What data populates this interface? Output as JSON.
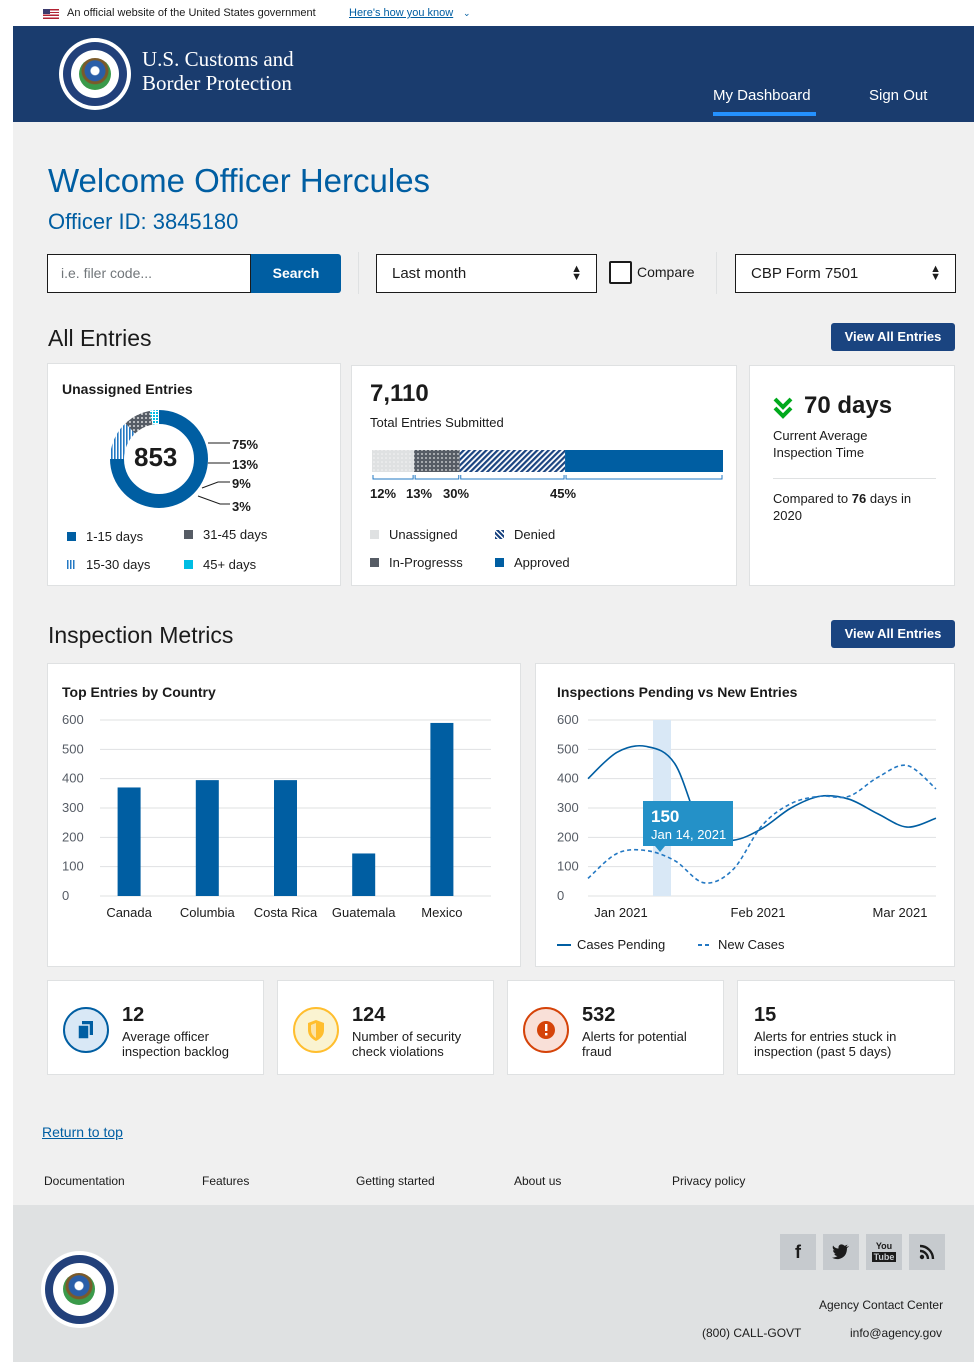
{
  "gov_banner": {
    "text": "An official website of the United States government",
    "link": "Here's how you know"
  },
  "header": {
    "agency_line1": "U.S. Customs and",
    "agency_line2": "Border Protection",
    "nav": [
      "My Dashboard",
      "Sign Out"
    ]
  },
  "welcome": {
    "title": "Welcome Officer Hercules",
    "officer_id": "Officer ID: 3845180"
  },
  "filters": {
    "search_placeholder": "i.e. filer code...",
    "search_button": "Search",
    "period_select": "Last month",
    "compare_label": "Compare",
    "form_select": "CBP Form 7501"
  },
  "all_entries": {
    "title": "All Entries",
    "view_button": "View All Entries",
    "unassigned": {
      "title": "Unassigned Entries",
      "total": "853",
      "percent_labels": [
        "75%",
        "13%",
        "9%",
        "3%"
      ],
      "legend": [
        "1-15 days",
        "31-45 days",
        "15-30 days",
        "45+ days"
      ]
    },
    "submitted": {
      "total": "7,110",
      "label": "Total Entries Submitted",
      "percent_labels": [
        "12%",
        "13%",
        "30%",
        "45%"
      ],
      "legend": [
        "Unassigned",
        "Denied",
        "In-Progresss",
        "Approved"
      ]
    },
    "inspection_time": {
      "value": "70 days",
      "label": "Current Average Inspection Time",
      "compare_prefix": "Compared to",
      "compare_value": "76",
      "compare_suffix": "days in 2020"
    }
  },
  "inspection_metrics": {
    "title": "Inspection Metrics",
    "view_button": "View All Entries"
  },
  "chart_data": [
    {
      "type": "bar",
      "title": "Top Entries by Country",
      "categories": [
        "Canada",
        "Columbia",
        "Costa Rica",
        "Guatemala",
        "Mexico"
      ],
      "values": [
        370,
        395,
        395,
        145,
        590
      ],
      "ylim": [
        0,
        600
      ],
      "yticks": [
        "600",
        "500",
        "400",
        "300",
        "200",
        "100",
        "0"
      ],
      "grid": true,
      "color": "#005ea2"
    },
    {
      "type": "line",
      "title": "Inspections Pending vs New Entries",
      "x_ticks": [
        "Jan 2021",
        "Feb 2021",
        "Mar 2021"
      ],
      "ylim": [
        0,
        600
      ],
      "yticks": [
        "600",
        "500",
        "400",
        "300",
        "200",
        "100",
        "0"
      ],
      "grid": true,
      "legend": "bottom",
      "series": [
        {
          "name": "Cases Pending",
          "style": "solid",
          "color": "#005ea2",
          "values": [
            400,
            490,
            510,
            450,
            210,
            190,
            230,
            300,
            340,
            330,
            280,
            235,
            265
          ]
        },
        {
          "name": "New Cases",
          "style": "dashed",
          "color": "#2378c3",
          "values": [
            60,
            145,
            155,
            120,
            45,
            90,
            240,
            315,
            340,
            340,
            405,
            445,
            365
          ]
        }
      ],
      "tooltip": {
        "value": "150",
        "date": "Jan 14, 2021"
      }
    }
  ],
  "stats": [
    {
      "num": "12",
      "line1": "Average officer",
      "line2": "inspection backlog",
      "icon": "copy-icon",
      "color": "#005ea2"
    },
    {
      "num": "124",
      "line1": "Number of security",
      "line2": "check violations",
      "icon": "shield-icon",
      "color": "#ffbe2e"
    },
    {
      "num": "532",
      "line1": "Alerts for potential",
      "line2": "fraud",
      "icon": "alert-icon",
      "color": "#d54309"
    },
    {
      "num": "15",
      "line1": "Alerts for entries stuck in",
      "line2": "inspection (past 5 days)",
      "icon": "",
      "color": ""
    }
  ],
  "footer": {
    "return_top": "Return to top",
    "links": [
      "Documentation",
      "Features",
      "Getting started",
      "About us",
      "Privacy policy"
    ],
    "contact_center": "Agency Contact Center",
    "phone": "(800) CALL-GOVT",
    "email": "info@agency.gov"
  }
}
